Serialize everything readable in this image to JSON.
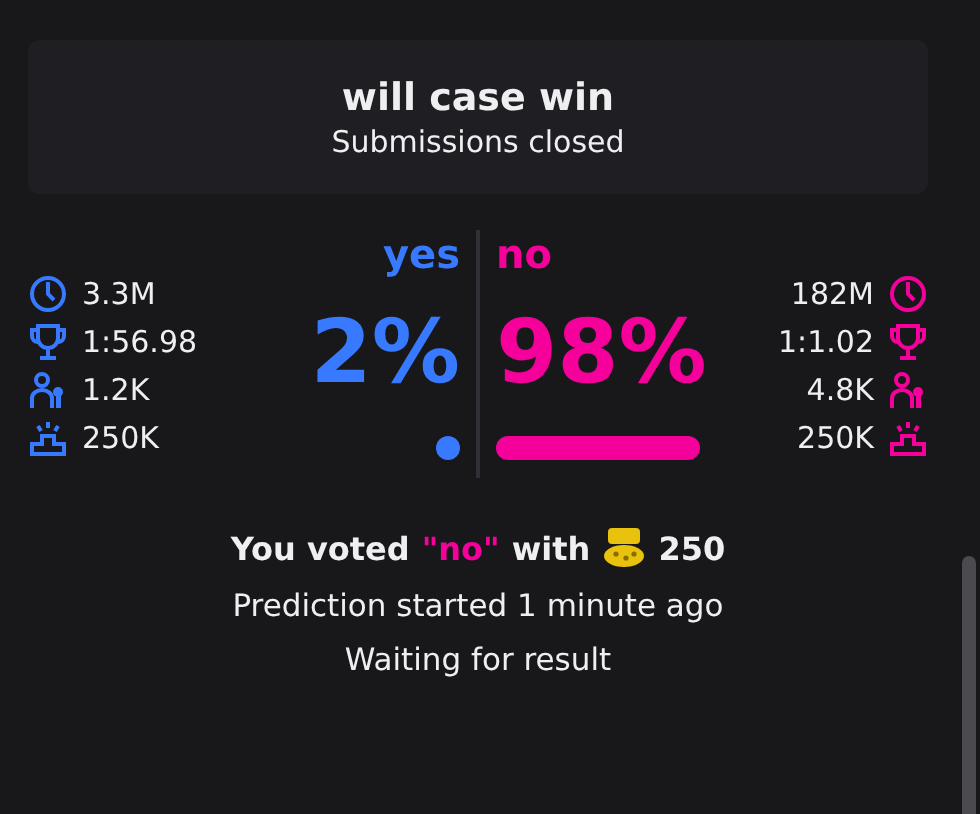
{
  "header": {
    "title": "will case win",
    "subtitle": "Submissions closed"
  },
  "outcomes": [
    {
      "label": "yes",
      "percent": "2%",
      "kind": "dot",
      "color": "#387aff",
      "stats": [
        {
          "kind": "clock",
          "value": "3.3M"
        },
        {
          "kind": "trophy",
          "value": "1:56.98"
        },
        {
          "kind": "users",
          "value": "1.2K"
        },
        {
          "kind": "podium",
          "value": "250K"
        }
      ]
    },
    {
      "label": "no",
      "percent": "98%",
      "kind": "bar",
      "color": "#f5009b",
      "stats": [
        {
          "kind": "clock",
          "value": "182M"
        },
        {
          "kind": "trophy",
          "value": "1:1.02"
        },
        {
          "kind": "users",
          "value": "4.8K"
        },
        {
          "kind": "podium",
          "value": "250K"
        }
      ]
    }
  ],
  "vote": {
    "prefix": "You voted",
    "choice": "\"no\"",
    "middle": "with",
    "amount": "250"
  },
  "status": [
    "Prediction started 1 minute ago",
    "Waiting for result"
  ]
}
